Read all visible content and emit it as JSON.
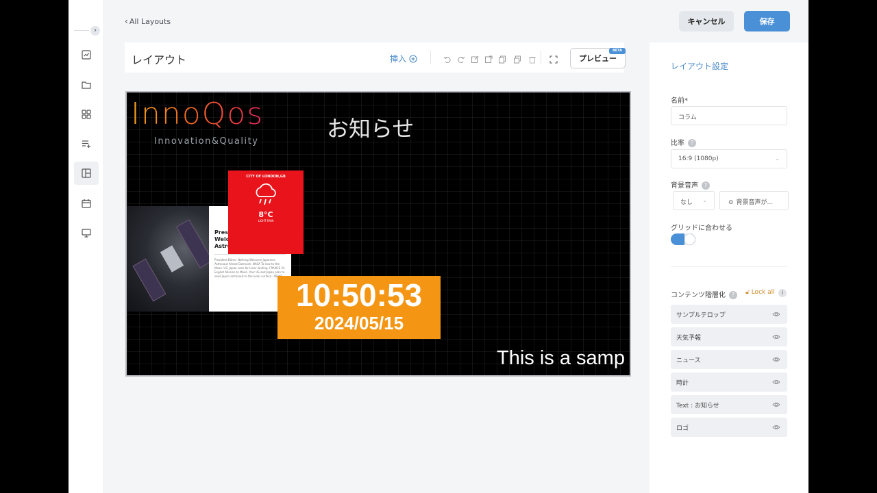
{
  "topbar": {
    "back_label": "All Layouts",
    "cancel_label": "キャンセル",
    "save_label": "保存"
  },
  "toolbar": {
    "title": "レイアウト",
    "insert_label": "挿入",
    "preview_label": "プレビュー",
    "beta_badge": "BETA"
  },
  "canvas": {
    "logo_text": "InnoQos",
    "logo_tagline": "Innovation&Quality",
    "notice_text": "お知らせ",
    "news": {
      "title": "Presi\nWelc\nAstro",
      "body": "President Biden: Nothing Welcome Japanese Astronaut Ahead Outreach. NASA To now to the Moon. US, Japan seek for lunar landing. FRANCE 24 English Mission to Moon. Your US and Japan plan to send japan astronaut to the lunar surface - NEWS"
    },
    "weather": {
      "city": "CITY OF LONDON,GB",
      "temp": "8°C",
      "condition": "LIGHT RAIN"
    },
    "clock": {
      "time": "10:50:53",
      "date": "2024/05/15"
    },
    "ticker_text": "This is a samp"
  },
  "settings": {
    "title": "レイアウト設定",
    "name_label": "名前*",
    "name_value": "コラム",
    "ratio_label": "比率",
    "ratio_value": "16:9 (1080p)",
    "bgm_label": "背景音声",
    "bgm_value": "なし",
    "bgm_button": "背景音声が...",
    "grid_label": "グリッドに合わせる",
    "grid_on": true,
    "layers_label": "コンテンツ階層化",
    "lock_all_label": "Lock all",
    "layers": [
      "サンプルテロップ",
      "天気予報",
      "ニュース",
      "時計",
      "Text : お知らせ",
      "ロゴ"
    ]
  },
  "colors": {
    "accent": "#4a90d6",
    "weather_bg": "#e8131b",
    "clock_bg": "#f49613"
  }
}
